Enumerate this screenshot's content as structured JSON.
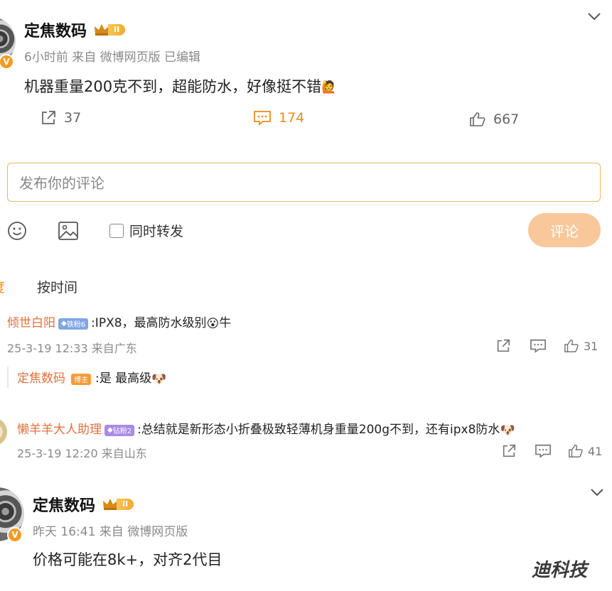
{
  "post1": {
    "author": "定焦数码",
    "level_badge": "II",
    "meta": "6小时前 来自 微博网页版 已编辑",
    "text": "机器重量200克不到，超能防水，好像挺不错",
    "text_emoji": "🙋",
    "repost_count": "37",
    "comment_count": "174",
    "like_count": "667"
  },
  "composer": {
    "placeholder": "发布你的评论",
    "repost_label": "同时转发",
    "submit_label": "评论"
  },
  "sort": {
    "partial_label": "度",
    "time_label": "按时间"
  },
  "comments": [
    {
      "author": "倾世白阳",
      "fan_badge": "铁粉6",
      "text": ":IPX8，最高防水级别",
      "emoji": "😮",
      "text_after": "牛",
      "meta": "25-3-19 12:33 来自广东",
      "like_count": "31"
    },
    {
      "author": "懒羊羊大人助理",
      "fan_badge": "钻粉2",
      "text": ":总结就是新形态小折叠极致轻薄机身重量200g不到，还有ipx8防水",
      "emoji": "🐶",
      "meta": "25-3-19 12:20 来自山东",
      "like_count": "41"
    }
  ],
  "reply": {
    "author": "定焦数码",
    "role_badge": "博主",
    "text": ":是 最高级",
    "emoji": "🐶"
  },
  "post2": {
    "author": "定焦数码",
    "level_badge": "II",
    "meta": "昨天 16:41 来自 微博网页版",
    "text": "价格可能在8k+，对齐2代目"
  },
  "watermark": "迪科技",
  "colors": {
    "accent": "#f08a1b",
    "comment_name": "#e2703a",
    "submit_bg": "#f8c89a",
    "verified": "#f59a23"
  }
}
